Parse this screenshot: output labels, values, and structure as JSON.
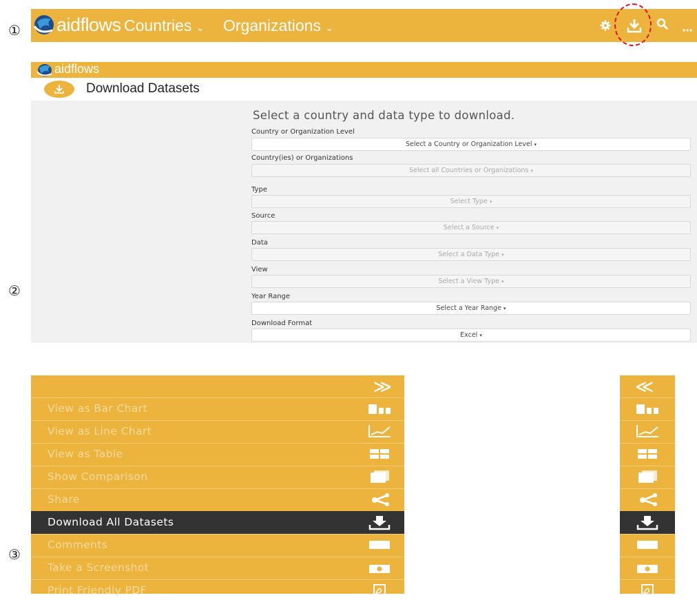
{
  "markers": [
    "①",
    "②",
    "③"
  ],
  "navbar": {
    "logo": "aidflows",
    "menu": [
      {
        "label": "Countries"
      },
      {
        "label": "Organizations"
      }
    ],
    "caret": "⌄",
    "icons": [
      "gear-icon",
      "download-icon",
      "search-icon",
      "more-icon"
    ],
    "highlight_color": "#e4101c",
    "bg_color": "#ecb43c"
  },
  "download_page": {
    "logo": "aidflows",
    "title": "Download Datasets",
    "form_heading": "Select a country and data type to download.",
    "caret": "▾",
    "fields": [
      {
        "label": "Country or Organization Level",
        "value": "Select a Country or Organization Level",
        "enabled": true
      },
      {
        "label": "Country(ies) or Organizations",
        "value": "Select all Countries or Organizations",
        "enabled": false
      },
      {
        "label": "Type",
        "value": "Select Type",
        "enabled": false
      },
      {
        "label": "Source",
        "value": "Select a Source",
        "enabled": false
      },
      {
        "label": "Data",
        "value": "Select a Data Type",
        "enabled": false
      },
      {
        "label": "View",
        "value": "Select a View Type",
        "enabled": false
      },
      {
        "label": "Year Range",
        "value": "Select a Year Range",
        "enabled": true
      },
      {
        "label": "Download Format",
        "value": "Excel",
        "enabled": true
      }
    ]
  },
  "sidebar": {
    "collapse_label": "≫",
    "expand_label": "≪",
    "items": [
      {
        "label": "View as Bar Chart",
        "icon": "bar-chart-icon",
        "active": false
      },
      {
        "label": "View as Line Chart",
        "icon": "line-chart-icon",
        "active": false
      },
      {
        "label": "View as Table",
        "icon": "table-icon",
        "active": false
      },
      {
        "label": "Show Comparison",
        "icon": "comparison-icon",
        "active": false
      },
      {
        "label": "Share",
        "icon": "share-icon",
        "active": false
      },
      {
        "label": "Download All Datasets",
        "icon": "download-icon",
        "active": true
      },
      {
        "label": "Comments",
        "icon": "comment-icon",
        "active": false
      },
      {
        "label": "Take a Screenshot",
        "icon": "camera-icon",
        "active": false
      },
      {
        "label": "Print Friendly PDF",
        "icon": "pdf-icon",
        "active": false
      }
    ]
  }
}
